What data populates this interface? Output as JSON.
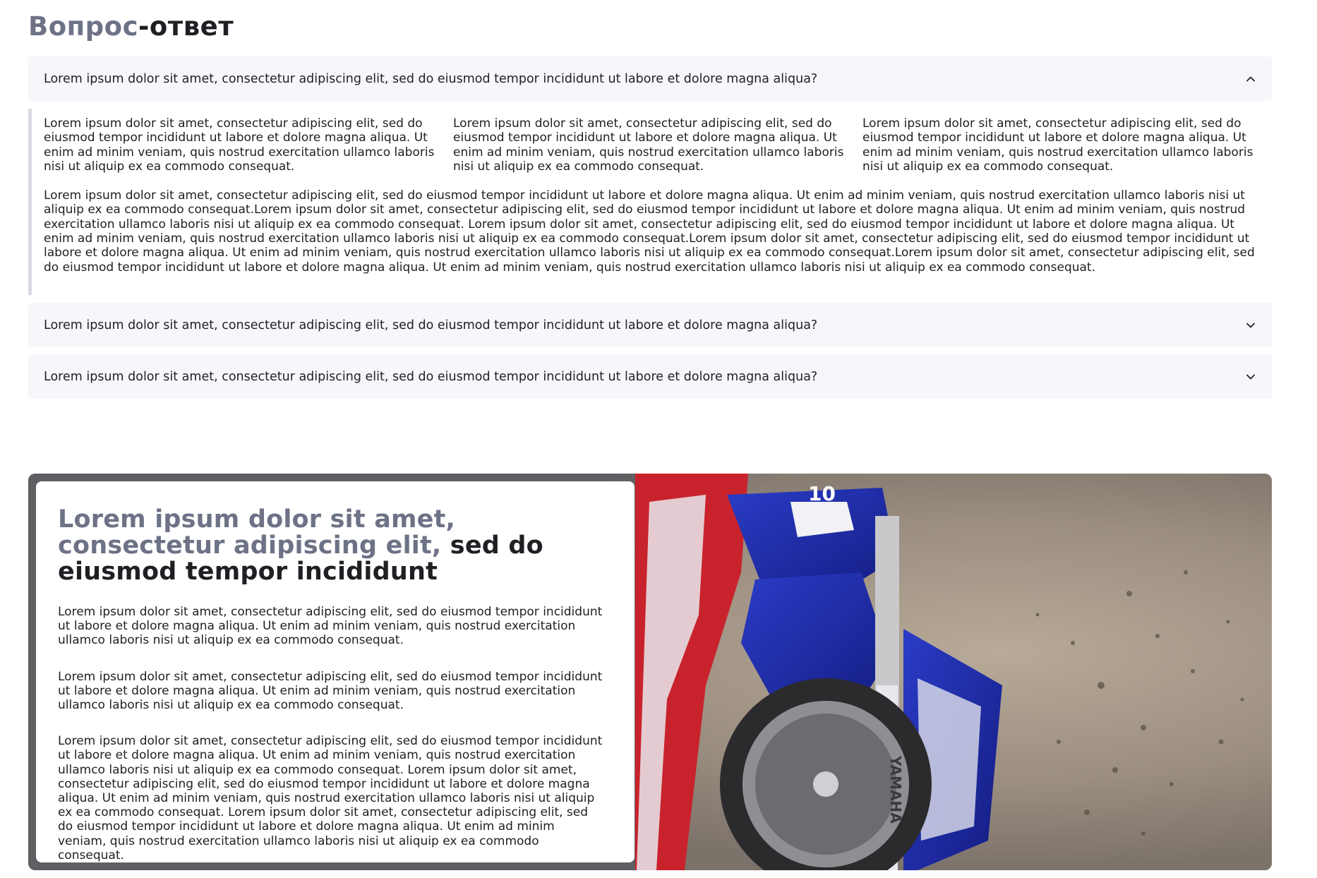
{
  "faq": {
    "title_part1": "Вопрос",
    "title_part2": "-ответ",
    "items": [
      {
        "question": "Lorem ipsum dolor sit amet, consectetur adipiscing elit, sed do eiusmod tempor incididunt ut labore et dolore magna aliqua?",
        "expanded": true,
        "icon": "chevron-up-icon"
      },
      {
        "question": "Lorem ipsum dolor sit amet, consectetur adipiscing elit, sed do eiusmod tempor incididunt ut labore et dolore magna aliqua?",
        "expanded": false,
        "icon": "chevron-down-icon"
      },
      {
        "question": "Lorem ipsum dolor sit amet, consectetur adipiscing elit, sed do eiusmod tempor incididunt ut labore et dolore magna aliqua?",
        "expanded": false,
        "icon": "chevron-down-icon"
      }
    ],
    "answer": {
      "columns": [
        "Lorem ipsum dolor sit amet, consectetur adipiscing elit, sed do eiusmod tempor incididunt ut labore et dolore magna aliqua. Ut enim ad minim veniam, quis nostrud exercitation ullamco laboris nisi ut aliquip ex ea commodo consequat.",
        "Lorem ipsum dolor sit amet, consectetur adipiscing elit, sed do eiusmod tempor incididunt ut labore et dolore magna aliqua. Ut enim ad minim veniam, quis nostrud exercitation ullamco laboris nisi ut aliquip ex ea commodo consequat.",
        "Lorem ipsum dolor sit amet, consectetur adipiscing elit, sed do eiusmod tempor incididunt ut labore et dolore magna aliqua. Ut enim ad minim veniam, quis nostrud exercitation ullamco laboris nisi ut aliquip ex ea commodo consequat."
      ],
      "long_text": "Lorem ipsum dolor sit amet, consectetur adipiscing elit, sed do eiusmod tempor incididunt ut labore et dolore magna aliqua. Ut enim ad minim veniam, quis nostrud exercitation ullamco laboris nisi ut aliquip ex ea commodo consequat.Lorem ipsum dolor sit amet, consectetur adipiscing elit, sed do eiusmod tempor incididunt ut labore et dolore magna aliqua. Ut enim ad minim veniam, quis nostrud exercitation ullamco laboris nisi ut aliquip ex ea commodo consequat. Lorem ipsum dolor sit amet, consectetur adipiscing elit, sed do eiusmod tempor incididunt ut labore et dolore magna aliqua. Ut enim ad minim veniam, quis nostrud exercitation ullamco laboris nisi ut aliquip ex ea commodo consequat.Lorem ipsum dolor sit amet, consectetur adipiscing elit, sed do eiusmod tempor incididunt ut labore et dolore magna aliqua. Ut enim ad minim veniam, quis nostrud exercitation ullamco laboris nisi ut aliquip ex ea commodo consequat.Lorem ipsum dolor sit amet, consectetur adipiscing elit, sed do eiusmod tempor incididunt ut labore et dolore magna aliqua. Ut enim ad minim veniam, quis nostrud exercitation ullamco laboris nisi ut aliquip ex ea commodo consequat."
    }
  },
  "hero": {
    "heading_muted": "Lorem ipsum dolor sit amet, consectetur adipiscing elit,",
    "heading_dark": " sed do eiusmod tempor incididunt",
    "paragraphs": [
      "Lorem ipsum dolor sit amet, consectetur adipiscing elit, sed do eiusmod tempor incididunt ut labore et dolore magna aliqua. Ut enim ad minim veniam, quis nostrud exercitation ullamco laboris nisi ut aliquip ex ea commodo consequat.",
      "Lorem ipsum dolor sit amet, consectetur adipiscing elit, sed do eiusmod tempor incididunt ut labore et dolore magna aliqua. Ut enim ad minim veniam, quis nostrud exercitation ullamco laboris nisi ut aliquip ex ea commodo consequat.",
      "Lorem ipsum dolor sit amet, consectetur adipiscing elit, sed do eiusmod tempor incididunt ut labore et dolore magna aliqua. Ut enim ad minim veniam, quis nostrud exercitation ullamco laboris nisi ut aliquip ex ea commodo consequat. Lorem ipsum dolor sit amet, consectetur adipiscing elit, sed do eiusmod tempor incididunt ut labore et dolore magna aliqua. Ut enim ad minim veniam, quis nostrud exercitation ullamco laboris nisi ut aliquip ex ea commodo consequat. Lorem ipsum dolor sit amet, consectetur adipiscing elit, sed do eiusmod tempor incididunt ut labore et dolore magna aliqua. Ut enim ad minim veniam, quis nostrud exercitation ullamco laboris nisi ut aliquip ex ea commodo consequat."
    ],
    "image": "motocross-rider-photo",
    "image_marks": {
      "number_plate": "10",
      "fork_brand": "YAMAHA"
    }
  },
  "colors": {
    "text": "#1f1f24",
    "muted": "#6d7286",
    "accordion_bg": "#f7f7fb",
    "answer_border": "#d9dbe4",
    "bike_blue": "#1f2fb0"
  }
}
